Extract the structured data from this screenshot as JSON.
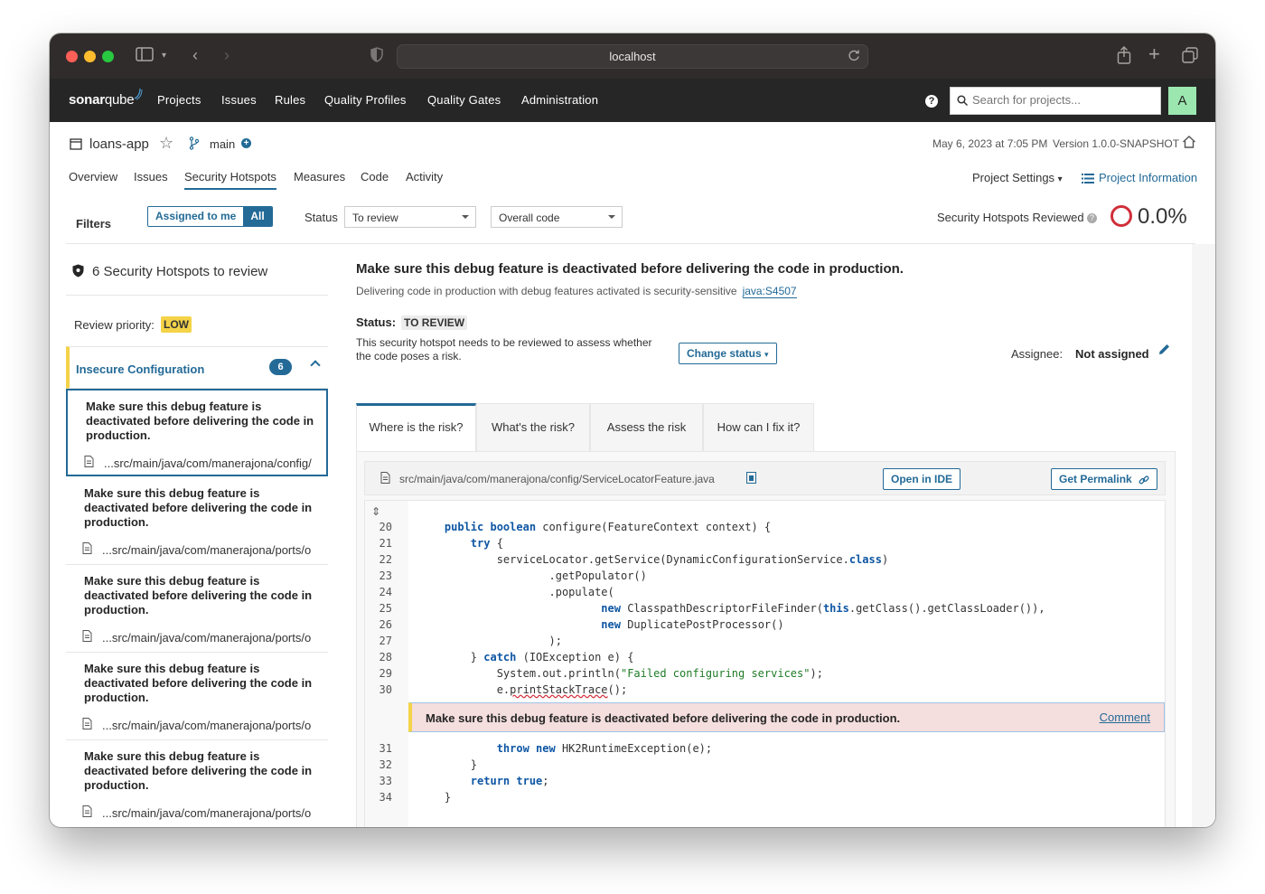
{
  "browser": {
    "url": "localhost"
  },
  "topnav": {
    "logo_a": "sonar",
    "logo_b": "qube",
    "items": [
      "Projects",
      "Issues",
      "Rules",
      "Quality Profiles",
      "Quality Gates",
      "Administration"
    ],
    "search_placeholder": "Search for projects...",
    "avatar": "A",
    "help": "?"
  },
  "project": {
    "name": "loans-app",
    "branch": "main",
    "date": "May 6, 2023 at 7:05 PM",
    "version": "Version 1.0.0-SNAPSHOT",
    "tabs": [
      "Overview",
      "Issues",
      "Security Hotspots",
      "Measures",
      "Code",
      "Activity"
    ],
    "settings": "Project Settings",
    "information": "Project Information"
  },
  "filters": {
    "label": "Filters",
    "assigned_to_me": "Assigned to me",
    "all": "All",
    "status_label": "Status",
    "status_value": "To review",
    "scope_value": "Overall code",
    "reviewed_label": "Security Hotspots Reviewed",
    "reviewed_pct": "0.0%"
  },
  "sidebar": {
    "title": "6 Security Hotspots to review",
    "priority_label": "Review priority:",
    "priority": "LOW",
    "category": "Insecure Configuration",
    "category_count": "6",
    "items": [
      {
        "message": "Make sure this debug feature is deactivated before delivering the code in production.",
        "path": "...src/main/java/com/manerajona/config/"
      },
      {
        "message": "Make sure this debug feature is deactivated before delivering the code in production.",
        "path": "...src/main/java/com/manerajona/ports/o"
      },
      {
        "message": "Make sure this debug feature is deactivated before delivering the code in production.",
        "path": "...src/main/java/com/manerajona/ports/o"
      },
      {
        "message": "Make sure this debug feature is deactivated before delivering the code in production.",
        "path": "...src/main/java/com/manerajona/ports/o"
      },
      {
        "message": "Make sure this debug feature is deactivated before delivering the code in production.",
        "path": "...src/main/java/com/manerajona/ports/o"
      }
    ]
  },
  "hotspot": {
    "title": "Make sure this debug feature is deactivated before delivering the code in production.",
    "subtitle": "Delivering code in production with debug features activated is security-sensitive",
    "rule": "java:S4507",
    "status_label": "Status:",
    "status": "TO REVIEW",
    "status_desc": "This security hotspot needs to be reviewed to assess whether the code poses a risk.",
    "change_status": "Change status",
    "assignee_label": "Assignee:",
    "assignee": "Not assigned",
    "tabs": [
      "Where is the risk?",
      "What's the risk?",
      "Assess the risk",
      "How can I fix it?"
    ],
    "file": "src/main/java/com/manerajona/config/ServiceLocatorFeature.java",
    "open_ide": "Open in IDE",
    "permalink": "Get Permalink",
    "issue_message": "Make sure this debug feature is deactivated before delivering the code in production.",
    "comment": "Comment",
    "line_numbers": [
      "20",
      "21",
      "22",
      "23",
      "24",
      "25",
      "26",
      "27",
      "28",
      "29",
      "30",
      "31",
      "32",
      "33",
      "34"
    ]
  },
  "colors": {
    "accent": "#236a97",
    "nav": "#262626",
    "priority": "#f4d348",
    "danger": "#d02f3a"
  }
}
